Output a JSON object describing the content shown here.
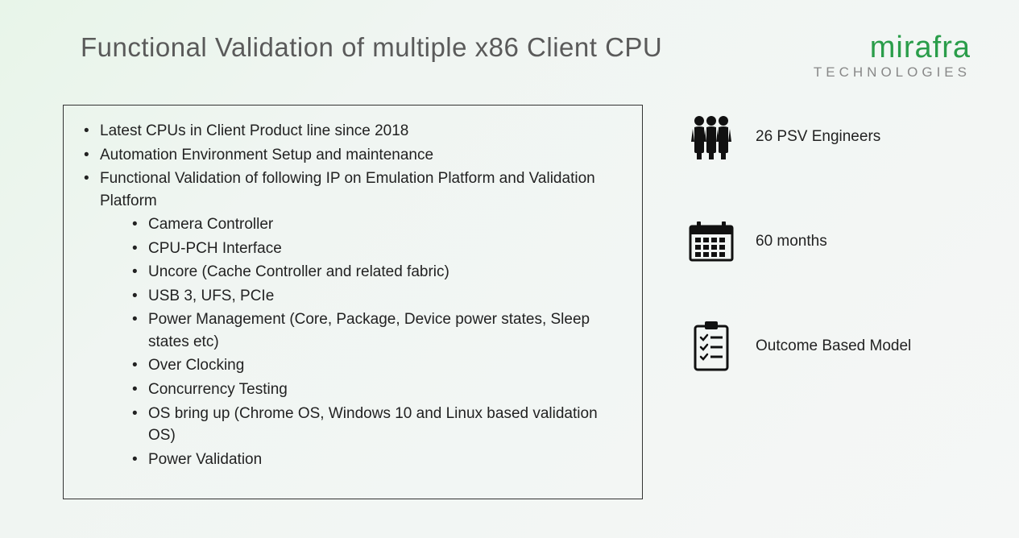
{
  "title": "Functional Validation of multiple x86 Client CPU",
  "logo": {
    "main": "mirafra",
    "sub": "TECHNOLOGIES"
  },
  "bullets": [
    "Latest CPUs in Client Product line since 2018",
    "Automation Environment Setup and maintenance",
    "Functional Validation of following IP on Emulation Platform and Validation Platform"
  ],
  "sub_bullets": [
    "Camera Controller",
    "CPU-PCH Interface",
    "Uncore (Cache Controller and related fabric)",
    "USB 3, UFS, PCIe",
    "Power Management (Core, Package, Device power states, Sleep states etc)",
    "Over Clocking",
    "Concurrency Testing",
    "OS bring up (Chrome OS, Windows 10 and Linux based validation OS)",
    "Power Validation"
  ],
  "stats": [
    {
      "icon": "people-icon",
      "label": "26 PSV Engineers"
    },
    {
      "icon": "calendar-icon",
      "label": "60 months"
    },
    {
      "icon": "clipboard-icon",
      "label": "Outcome Based Model"
    }
  ]
}
